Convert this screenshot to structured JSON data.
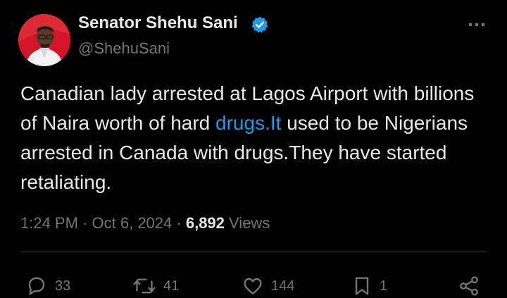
{
  "author": {
    "display_name": "Senator Shehu Sani",
    "handle": "@ShehuSani",
    "avatar_icon": "user-avatar",
    "verified_icon": "verified-badge-icon",
    "verified_color": "#1d9bf0"
  },
  "tweet": {
    "text_part1": "Canadian lady arrested at Lagos Airport with billions of Naira worth of hard ",
    "text_link": "drugs.It",
    "text_part2": " used to be Nigerians arrested in Canada with drugs.They have started retaliating.",
    "link_color": "#1d9bf0",
    "time": "1:24 PM",
    "separator": "·",
    "date": "Oct 6, 2024",
    "views_count": "6,892",
    "views_label": "Views"
  },
  "actions": {
    "reply": {
      "icon": "reply-icon",
      "count": "33"
    },
    "repost": {
      "icon": "repost-icon",
      "count": "41"
    },
    "like": {
      "icon": "like-icon",
      "count": "144"
    },
    "bookmark": {
      "icon": "bookmark-icon",
      "count": "1"
    },
    "share": {
      "icon": "share-icon"
    }
  },
  "menu": {
    "icon": "more-options-icon"
  }
}
